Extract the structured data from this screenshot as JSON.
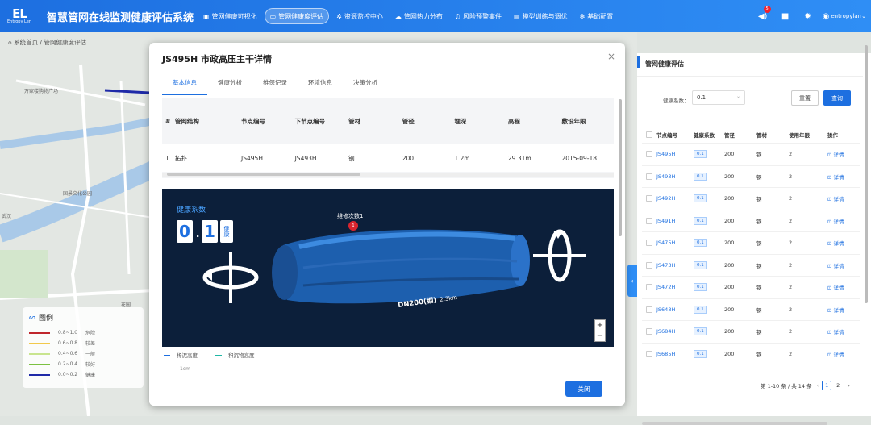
{
  "app": {
    "logo_mark": "EL",
    "brand": "Entropy Len",
    "title": "智慧管网在线监测健康评估系统"
  },
  "nav": [
    {
      "icon": "chart-icon",
      "label": "管网健康可视化",
      "active": false
    },
    {
      "icon": "monitor-icon",
      "label": "管网健康度评估",
      "active": true
    },
    {
      "icon": "gear-icon",
      "label": "资源监控中心",
      "active": false
    },
    {
      "icon": "heat-icon",
      "label": "管网热力分布",
      "active": false
    },
    {
      "icon": "bell-icon",
      "label": "风险预警事件",
      "active": false
    },
    {
      "icon": "model-icon",
      "label": "模型训练与调优",
      "active": false
    },
    {
      "icon": "settings-icon",
      "label": "基础配置",
      "active": false
    }
  ],
  "tools": {
    "notification_count": "5",
    "user": "entropylan"
  },
  "breadcrumb": {
    "home": "系统首页",
    "sep": "/",
    "current": "管网健康度评估"
  },
  "legend": {
    "title": "图例",
    "items": [
      {
        "range": "0.8~1.0",
        "label": "危险",
        "color": "#c0262d"
      },
      {
        "range": "0.6~0.8",
        "label": "较差",
        "color": "#f2c94c"
      },
      {
        "range": "0.4~0.6",
        "label": "一般",
        "color": "#c9e58f"
      },
      {
        "range": "0.2~0.4",
        "label": "较好",
        "color": "#7cc142"
      },
      {
        "range": "0.0~0.2",
        "label": "健康",
        "color": "#1f2aa8"
      }
    ]
  },
  "modal": {
    "title": "JS495H 市政高压主干详情",
    "close": "×",
    "tabs": [
      "基本信息",
      "健康分析",
      "维保记录",
      "环境信息",
      "决策分析"
    ],
    "table": {
      "headers": [
        "#",
        "管网结构",
        "节点编号",
        "下节点编号",
        "管材",
        "管径",
        "埋深",
        "高程",
        "敷设年限"
      ],
      "rows": [
        [
          "1",
          "拓扑",
          "JS495H",
          "JS493H",
          "钢",
          "200",
          "1.2m",
          "29.31m",
          "2015-09-18"
        ]
      ]
    },
    "viewer": {
      "health_label": "健康系数",
      "digit1": "0",
      "dot": ".",
      "digit2": "1",
      "unit": "健康",
      "repair_label": "维修次数1",
      "repair_marker": "1",
      "pipe_label": "DN200(钢)",
      "pipe_length": "2.3km",
      "zoom_in": "+",
      "zoom_out": "−"
    },
    "chart_legend": [
      "稀泥高度",
      "积沉物高度"
    ],
    "axis_label": "1cm",
    "close_button": "关闭"
  },
  "right_panel": {
    "title": "管网健康评估",
    "filter_label": "健康系数：",
    "filter_value": "0.1",
    "reset": "重置",
    "query": "查询",
    "headers": [
      "节点编号",
      "健康系数",
      "管径",
      "管材",
      "使用年限",
      "操作"
    ],
    "rows": [
      {
        "id": "JS495H",
        "hc": "0.1",
        "dia": "200",
        "mat": "钢",
        "years": "2",
        "op": "详情"
      },
      {
        "id": "JS493H",
        "hc": "0.1",
        "dia": "200",
        "mat": "钢",
        "years": "2",
        "op": "详情"
      },
      {
        "id": "JS492H",
        "hc": "0.1",
        "dia": "200",
        "mat": "钢",
        "years": "2",
        "op": "详情"
      },
      {
        "id": "JS491H",
        "hc": "0.1",
        "dia": "200",
        "mat": "钢",
        "years": "2",
        "op": "详情"
      },
      {
        "id": "JS475H",
        "hc": "0.1",
        "dia": "200",
        "mat": "钢",
        "years": "2",
        "op": "详情"
      },
      {
        "id": "JS473H",
        "hc": "0.1",
        "dia": "200",
        "mat": "钢",
        "years": "2",
        "op": "详情"
      },
      {
        "id": "JS472H",
        "hc": "0.1",
        "dia": "200",
        "mat": "钢",
        "years": "2",
        "op": "详情"
      },
      {
        "id": "JS648H",
        "hc": "0.1",
        "dia": "200",
        "mat": "钢",
        "years": "2",
        "op": "详情"
      },
      {
        "id": "JS684H",
        "hc": "0.1",
        "dia": "200",
        "mat": "钢",
        "years": "2",
        "op": "详情"
      },
      {
        "id": "JS685H",
        "hc": "0.1",
        "dia": "200",
        "mat": "钢",
        "years": "2",
        "op": "详情"
      }
    ],
    "pager": {
      "summary": "第 1-10 条 / 共 14 条",
      "prev": "‹",
      "page1": "1",
      "page2": "2",
      "next": "›"
    }
  },
  "map_labels": [
    "万家楼购物广场",
    "国景文化公园",
    "花园",
    "武汉"
  ]
}
